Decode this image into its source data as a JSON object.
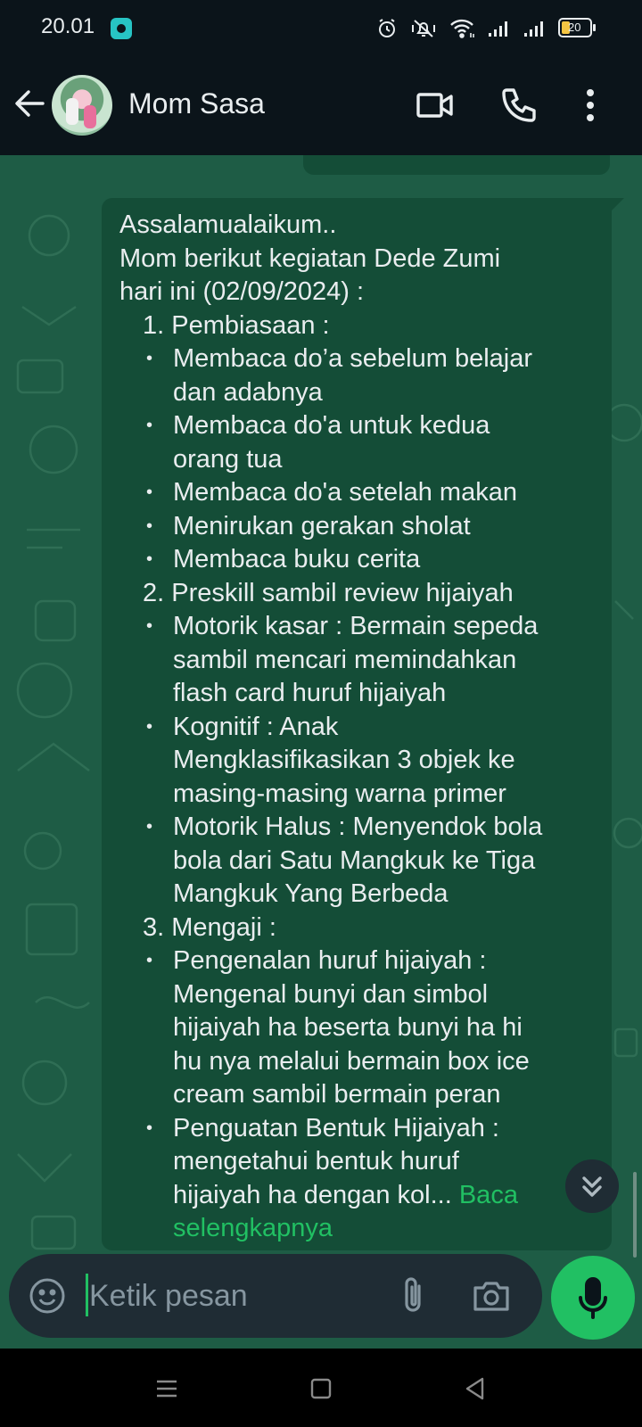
{
  "status_bar": {
    "time": "20.01",
    "battery_level": "20",
    "icons": [
      "app-notification-icon",
      "alarm-icon",
      "mute-vibrate-icon",
      "wifi-icon",
      "signal-icon",
      "signal-icon",
      "battery-icon"
    ]
  },
  "header": {
    "contact_name": "Mom Sasa",
    "icons": [
      "back-arrow-icon",
      "avatar",
      "video-call-icon",
      "voice-call-icon",
      "more-vert-icon"
    ]
  },
  "message": {
    "lines": [
      {
        "kind": "text",
        "text": "Assalamualaikum.."
      },
      {
        "kind": "text",
        "text": "Mom berikut kegiatan Dede Zumi"
      },
      {
        "kind": "text",
        "text": "hari ini (02/09/2024) :"
      },
      {
        "kind": "num",
        "text": "1. Pembiasaan :"
      },
      {
        "kind": "bullet",
        "text": "Membaca do’a sebelum belajar"
      },
      {
        "kind": "cont",
        "text": "dan adabnya"
      },
      {
        "kind": "bullet",
        "text": "Membaca do'a untuk kedua"
      },
      {
        "kind": "cont",
        "text": "orang tua"
      },
      {
        "kind": "bullet",
        "text": "Membaca do'a setelah makan"
      },
      {
        "kind": "bullet",
        "text": "Menirukan gerakan sholat"
      },
      {
        "kind": "bullet",
        "text": "Membaca buku cerita"
      },
      {
        "kind": "num",
        "text": "2. Preskill sambil review hijaiyah"
      },
      {
        "kind": "bullet",
        "text": "Motorik kasar :  Bermain sepeda"
      },
      {
        "kind": "cont",
        "text": "sambil mencari memindahkan"
      },
      {
        "kind": "cont",
        "text": "flash card huruf hijaiyah"
      },
      {
        "kind": "bullet",
        "text": "Kognitif : Anak"
      },
      {
        "kind": "cont",
        "text": "Mengklasifikasikan 3 objek ke"
      },
      {
        "kind": "cont",
        "text": "masing-masing warna primer"
      },
      {
        "kind": "bullet",
        "text": "Motorik Halus :  Menyendok bola"
      },
      {
        "kind": "cont",
        "text": "bola dari Satu Mangkuk ke Tiga"
      },
      {
        "kind": "cont",
        "text": "Mangkuk Yang Berbeda"
      },
      {
        "kind": "num",
        "text": "3. Mengaji :"
      },
      {
        "kind": "bullet",
        "text": "Pengenalan huruf hijaiyah :"
      },
      {
        "kind": "cont",
        "text": "Mengenal bunyi dan simbol"
      },
      {
        "kind": "cont",
        "text": "hijaiyah ha beserta bunyi ha hi"
      },
      {
        "kind": "cont",
        "text": "hu nya melalui bermain box ice"
      },
      {
        "kind": "cont",
        "text": "cream sambil bermain peran"
      },
      {
        "kind": "bullet",
        "text": "Penguatan Bentuk Hijaiyah :"
      },
      {
        "kind": "cont",
        "text": "mengetahui bentuk huruf"
      }
    ],
    "last_line_text": "hijaiyah ha dengan kol... ",
    "read_more_1": "Baca",
    "read_more_2": "selengkapnya"
  },
  "composer": {
    "placeholder": "Ketik pesan",
    "icons": [
      "emoji-icon",
      "attach-icon",
      "camera-icon",
      "mic-icon"
    ]
  },
  "colors": {
    "background": "#0b141a",
    "chat_wallpaper": "#1e5c45",
    "bubble": "#144d37",
    "accent": "#21c063",
    "text": "#e9edef",
    "muted": "#8696a0"
  }
}
